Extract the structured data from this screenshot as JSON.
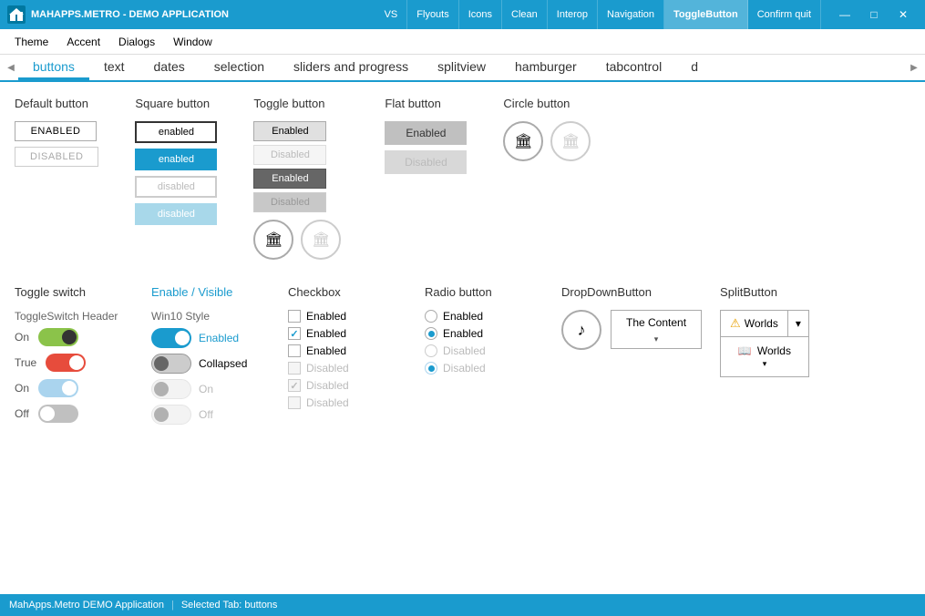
{
  "titlebar": {
    "icon": "🏢",
    "title": "MAHAPPS.METRO - DEMO APPLICATION",
    "nav": [
      "VS",
      "Flyouts",
      "Icons",
      "Clean",
      "Interop",
      "Navigation",
      "ToggleButton",
      "Confirm quit"
    ],
    "active_nav": "ToggleButton",
    "controls": [
      "—",
      "□",
      "✕"
    ]
  },
  "menubar": {
    "items": [
      "Theme",
      "Accent",
      "Dialogs",
      "Window"
    ]
  },
  "scrolltabs": {
    "tabs": [
      "buttons",
      "text",
      "dates",
      "selection",
      "sliders and progress",
      "splitview",
      "hamburger",
      "tabcontrol",
      "d"
    ],
    "active": "buttons",
    "scroll_left": "◀",
    "scroll_right": "▶"
  },
  "sections": {
    "default_button": {
      "title": "Default button",
      "enabled_label": "ENABLED",
      "disabled_label": "DISABLED"
    },
    "square_button": {
      "title": "Square button",
      "labels": [
        "enabled",
        "enabled",
        "disabled",
        "disabled"
      ]
    },
    "toggle_button": {
      "title": "Toggle button",
      "labels": [
        "Enabled",
        "Disabled",
        "Enabled",
        "Disabled"
      ]
    },
    "flat_button": {
      "title": "Flat button",
      "labels": [
        "Enabled",
        "Disabled"
      ]
    },
    "circle_button": {
      "title": "Circle button"
    }
  },
  "row2": {
    "toggle_switch": {
      "title": "Toggle switch",
      "header": "ToggleSwitch Header",
      "rows": [
        {
          "label": "On",
          "state": "on"
        },
        {
          "label": "True",
          "state": "on_red"
        },
        {
          "label": "On",
          "state": "light"
        },
        {
          "label": "Off",
          "state": "off"
        }
      ]
    },
    "enable_visible": {
      "title": "Enable / Visible",
      "subtitle": "Win10 Style",
      "toggles": [
        {
          "label": "Enabled",
          "state": "on"
        },
        {
          "label": "Collapsed",
          "state": "off"
        },
        {
          "label": "On",
          "state": "disabled"
        },
        {
          "label": "Off",
          "state": "disabled_off"
        }
      ]
    },
    "checkbox": {
      "title": "Checkbox",
      "items": [
        {
          "label": "Enabled",
          "checked": false,
          "disabled": false
        },
        {
          "label": "Enabled",
          "checked": true,
          "disabled": false
        },
        {
          "label": "Enabled",
          "checked": false,
          "disabled": false
        },
        {
          "label": "Disabled",
          "checked": false,
          "disabled": true
        },
        {
          "label": "Disabled",
          "checked": true,
          "disabled": true
        },
        {
          "label": "Disabled",
          "checked": false,
          "disabled": true
        }
      ]
    },
    "radio_button": {
      "title": "Radio button",
      "items": [
        {
          "label": "Enabled",
          "checked": false,
          "disabled": false
        },
        {
          "label": "Enabled",
          "checked": true,
          "disabled": false
        },
        {
          "label": "Disabled",
          "checked": false,
          "disabled": true
        },
        {
          "label": "Disabled",
          "checked": true,
          "disabled": true
        }
      ]
    },
    "dropdown_button": {
      "title": "DropDownButton",
      "content_label": "The Content",
      "arrow": "▾"
    },
    "split_button": {
      "title": "SplitButton",
      "top_label": "Worlds",
      "bottom_label": "Worlds",
      "arrow": "▾",
      "warning_icon": "⚠"
    }
  },
  "statusbar": {
    "app_name": "MahApps.Metro DEMO Application",
    "separator": "|",
    "tab_info": "Selected Tab:  buttons"
  }
}
